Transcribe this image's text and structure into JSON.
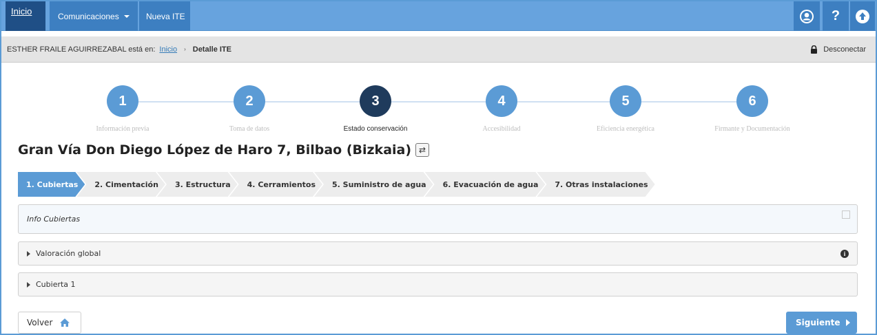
{
  "nav": {
    "home": "Inicio",
    "comunicaciones": "Comunicaciones",
    "nueva_ite": "Nueva ITE",
    "icons": [
      "user-icon",
      "help-icon",
      "upload-icon"
    ]
  },
  "breadcrumb": {
    "user_prefix": "ESTHER FRAILE AGUIRREZABAL está en:",
    "home_link": "Inicio",
    "separator": "›",
    "current": "Detalle ITE",
    "logout": "Desconectar"
  },
  "steps": [
    {
      "number": "1",
      "label": "Información previa"
    },
    {
      "number": "2",
      "label": "Toma de datos"
    },
    {
      "number": "3",
      "label": "Estado conservación"
    },
    {
      "number": "4",
      "label": "Accesibilidad"
    },
    {
      "number": "5",
      "label": "Eficiencia energética"
    },
    {
      "number": "6",
      "label": "Firmante y Documentación"
    }
  ],
  "active_step": 3,
  "title": "Gran Vía Don Diego López de Haro 7, Bilbao (Bizkaia)",
  "tabs": [
    "1. Cubiertas",
    "2. Cimentación",
    "3. Estructura",
    "4. Cerramientos",
    "5. Suministro de agua",
    "6. Evacuación de agua",
    "7. Otras instalaciones"
  ],
  "panels": {
    "info": "Info Cubiertas",
    "valoracion": "Valoración global",
    "cubierta": "Cubierta 1",
    "info_badge": "i"
  },
  "buttons": {
    "back": "Volver",
    "next": "Siguiente"
  },
  "colors": {
    "primary": "#5b9bd5",
    "nav_dark": "#1f4f86",
    "active_step": "#1f3b5c"
  }
}
